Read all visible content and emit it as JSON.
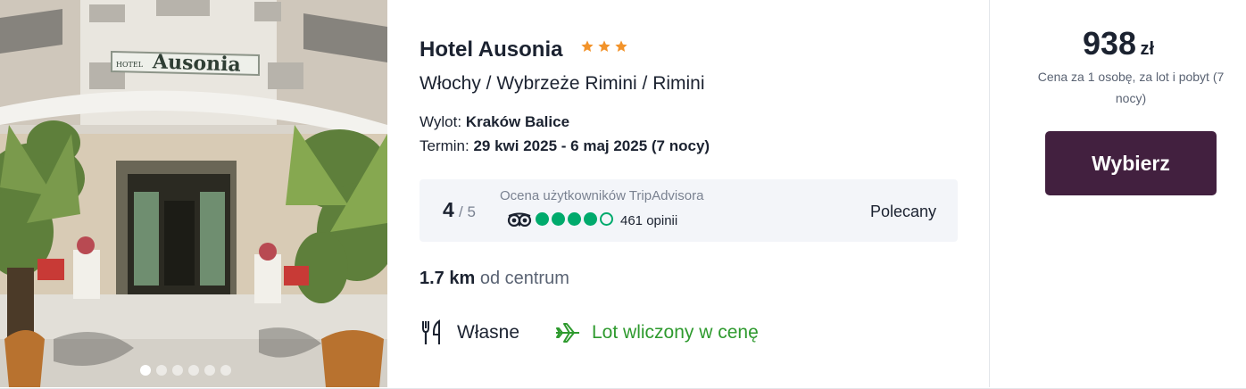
{
  "hotel": {
    "name": "Hotel Ausonia",
    "star_count": 3,
    "star_color": "#f2932a",
    "location": "Włochy / Wybrzeże Rimini / Rimini",
    "photo_sign_text": "Ausonia",
    "photo_sign_small": "HOTEL",
    "photo_gallery": {
      "count": 6,
      "active_index": 0
    }
  },
  "departure": {
    "label": "Wylot:",
    "value": "Kraków Balice"
  },
  "term": {
    "label": "Termin:",
    "value": "29 kwi 2025 - 6 maj 2025 (7 nocy)"
  },
  "rating": {
    "score": "4",
    "max": "/ 5",
    "source_label": "Ocena użytkowników TripAdvisora",
    "bubbles_filled": 4,
    "bubbles_total": 5,
    "reviews": "461 opinii",
    "verdict": "Polecany",
    "bubble_color": "#00aa6c",
    "icon": "tripadvisor-owl-icon"
  },
  "distance": {
    "value": "1.7 km",
    "suffix": "od centrum"
  },
  "amenities": {
    "meal": {
      "icon": "cutlery-icon",
      "label": "Własne"
    },
    "flight": {
      "icon": "plane-icon",
      "label": "Lot wliczony w cenę",
      "color": "#2e9a2e"
    }
  },
  "price": {
    "amount": "938",
    "currency": "zł",
    "note": "Cena za 1 osobę, za lot i pobyt (7 nocy)"
  },
  "cta": {
    "label": "Wybierz",
    "color": "#42203f"
  }
}
